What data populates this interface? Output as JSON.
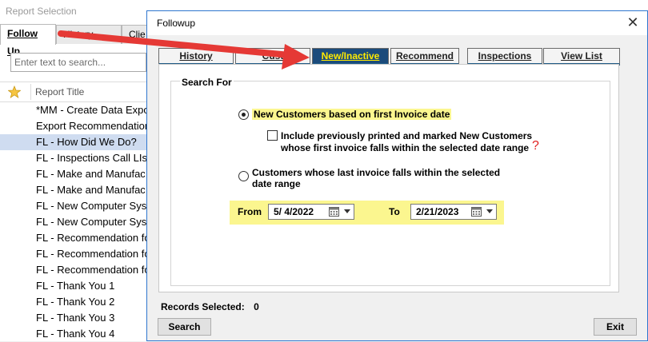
{
  "background_window": {
    "title": "Report Selection",
    "tabs": [
      "Follow Up",
      "History",
      "Clie"
    ],
    "search_placeholder": "Enter text to search...",
    "column_header": "Report Title",
    "rows": [
      "*MM - Create Data Expo",
      "Export Recommendation",
      "FL - How Did We Do?",
      "FL - Inspections Call LIs",
      "FL - Make and Manufac",
      "FL - Make and Manufac",
      "FL - New Computer Sys",
      "FL - New Computer Sys",
      "FL - Recommendation fo",
      "FL - Recommendation fo",
      "FL - Recommendation fo",
      "FL - Thank You 1",
      "FL - Thank You 2",
      "FL - Thank You 3",
      "FL - Thank You 4"
    ],
    "selected_row_index": 2
  },
  "dialog": {
    "title": "Followup",
    "close_glyph": "✕",
    "tabs": [
      "History",
      "Cust",
      "New/Inactive",
      "Recommend",
      "Inspections",
      "View List"
    ],
    "active_tab": "New/Inactive",
    "group_label": "Search For",
    "option_new_customers": "New Customers based on first Invoice date",
    "include_line1": "Include previously printed and marked New Customers",
    "include_line2": "whose first invoice falls within the selected date range",
    "help_glyph": "?",
    "option_last_invoice_line1": "Customers whose last invoice falls within the selected",
    "option_last_invoice_line2": "date range",
    "from_label": "From",
    "from_date": "5/ 4/2022",
    "to_label": "To",
    "to_date": "2/21/2023",
    "records_label": "Records Selected:",
    "records_count": "0",
    "search_button": "Search",
    "exit_button": "Exit"
  },
  "colors": {
    "active_tab_bg": "#1b4b7b",
    "active_tab_text": "#ffea00",
    "highlight": "#fbf68f",
    "annotation_arrow": "#e53935"
  }
}
